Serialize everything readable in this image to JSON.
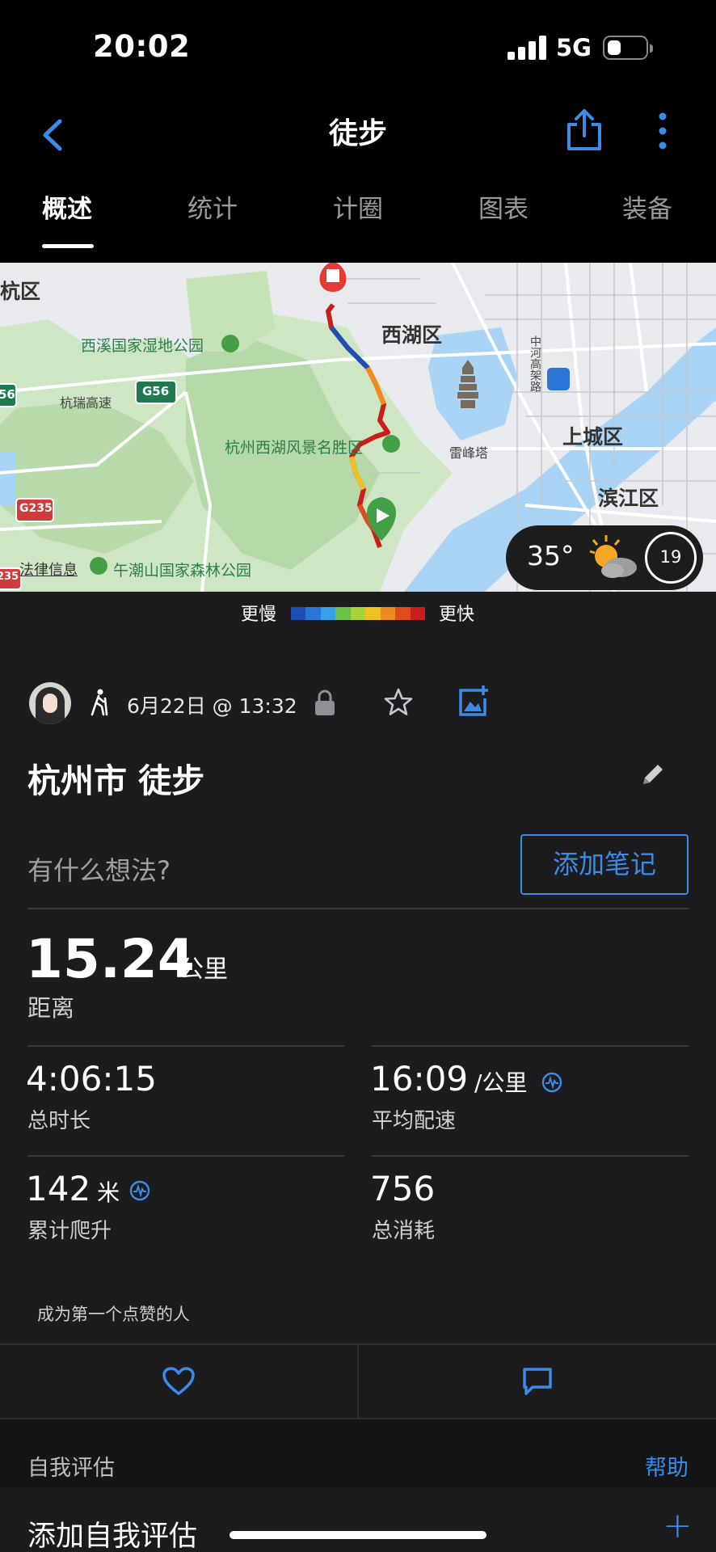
{
  "status_bar": {
    "time": "20:02",
    "network": "5G"
  },
  "nav": {
    "title": "徒步"
  },
  "tabs": [
    {
      "label": "概述",
      "active": true
    },
    {
      "label": "统计",
      "active": false
    },
    {
      "label": "计圈",
      "active": false
    },
    {
      "label": "图表",
      "active": false
    },
    {
      "label": "装备",
      "active": false
    }
  ],
  "map": {
    "labels": {
      "hangzhou_district": "杭区",
      "xixi_park": "西溪国家湿地公园",
      "xihu_district": "西湖区",
      "g56": "G56",
      "g56_partial": "56",
      "hangrui": "杭瑞高速",
      "scenic": "杭州西湖风景名胜区",
      "leifeng": "雷峰塔",
      "shangcheng": "上城区",
      "binjiang": "滨江区",
      "zhonghe": "中河高架路",
      "g235": "G235",
      "g235_partial": "235",
      "legal": "法律信息",
      "wuchao": "午潮山国家森林公园"
    },
    "weather": {
      "temperature": "35°",
      "wind_speed": "19"
    }
  },
  "pace_legend": {
    "slow_label": "更慢",
    "fast_label": "更快",
    "colors": [
      "#1f4fb4",
      "#2a74d6",
      "#38a0e8",
      "#6cc04a",
      "#a7d23a",
      "#f0c020",
      "#f08a20",
      "#e04a20",
      "#c81e1e"
    ]
  },
  "activity": {
    "date": "6月22日 @ 13:32",
    "title": "杭州市 徒步",
    "note_placeholder": "有什么想法?",
    "add_note_label": "添加笔记",
    "distance": {
      "value": "15.24",
      "unit": "公里",
      "label": "距离"
    },
    "stats": {
      "duration": {
        "value": "4:06:15",
        "label": "总时长"
      },
      "pace": {
        "value": "16:09",
        "unit": "/公里",
        "label": "平均配速"
      },
      "ascent": {
        "value": "142",
        "unit": "米",
        "label": "累计爬升"
      },
      "calories": {
        "value": "756",
        "label": "总消耗"
      }
    },
    "likes_text": "成为第一个点赞的人"
  },
  "self_eval": {
    "title": "自我评估",
    "help_label": "帮助",
    "add_label": "添加自我评估"
  },
  "accent_color": "#3c8ce7"
}
